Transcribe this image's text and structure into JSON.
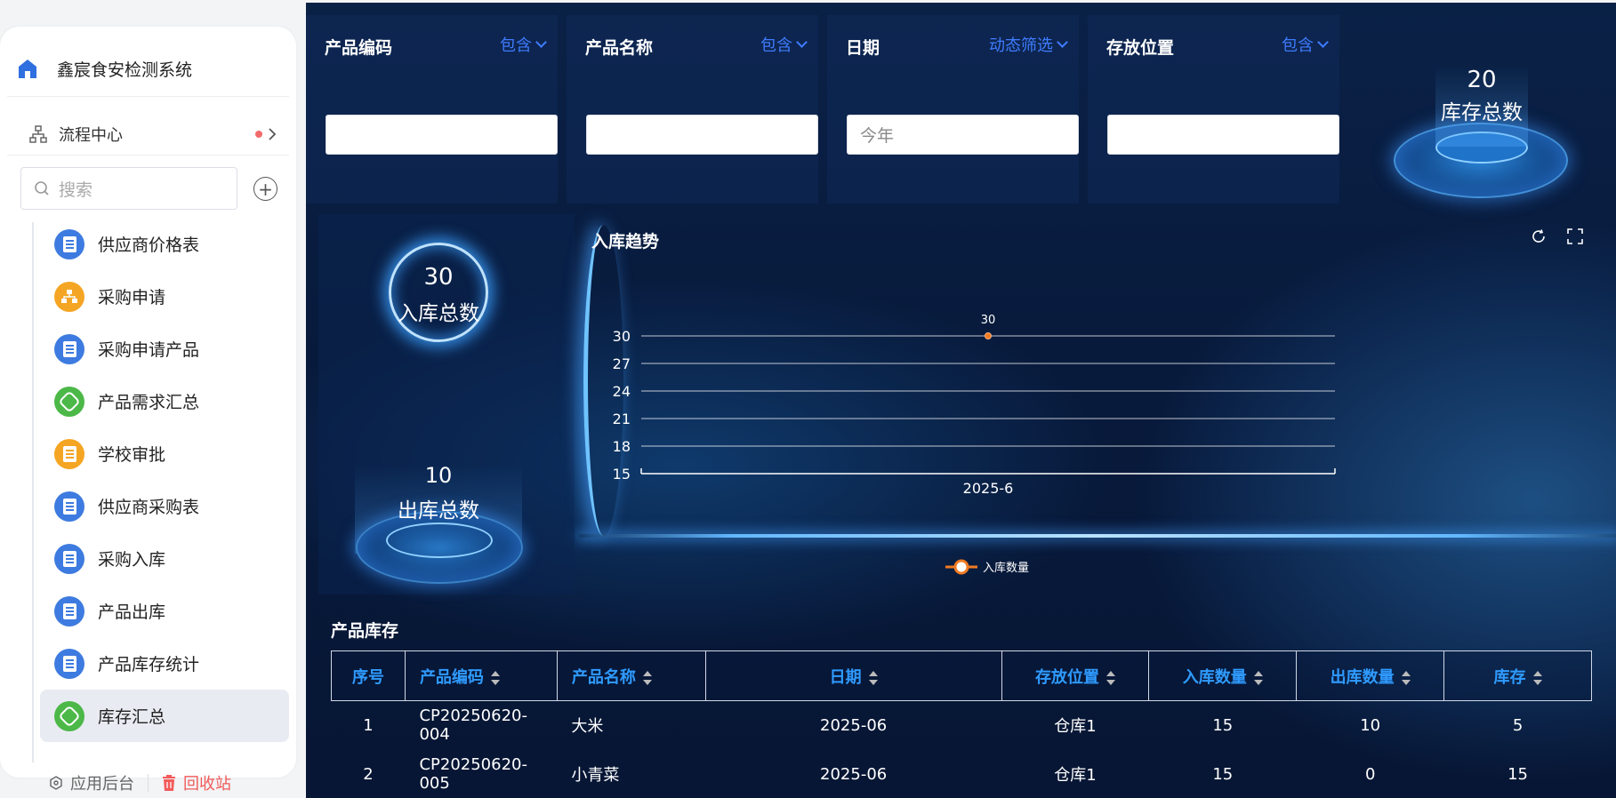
{
  "app": {
    "title": "鑫宸食安检测系统"
  },
  "sidebar": {
    "flow_center": "流程中心",
    "search_placeholder": "搜索",
    "items": [
      {
        "label": "供应商价格表",
        "icon": "document-icon",
        "color": "#3e7be0"
      },
      {
        "label": "采购申请",
        "icon": "org-icon",
        "color": "#f5a524"
      },
      {
        "label": "采购申请产品",
        "icon": "document-icon",
        "color": "#3e7be0"
      },
      {
        "label": "产品需求汇总",
        "icon": "dashboard-icon",
        "color": "#4cb848"
      },
      {
        "label": "学校审批",
        "icon": "document-icon",
        "color": "#f5a524"
      },
      {
        "label": "供应商采购表",
        "icon": "document-icon",
        "color": "#3e7be0"
      },
      {
        "label": "采购入库",
        "icon": "document-icon",
        "color": "#3e7be0"
      },
      {
        "label": "产品出库",
        "icon": "document-icon",
        "color": "#3e7be0"
      },
      {
        "label": "产品库存统计",
        "icon": "document-icon",
        "color": "#3e7be0"
      },
      {
        "label": "库存汇总",
        "icon": "dashboard-icon",
        "color": "#4cb848",
        "active": true
      }
    ],
    "bottom": {
      "admin": "应用后台",
      "recycle": "回收站"
    }
  },
  "filters": [
    {
      "label": "产品编码",
      "mode": "包含",
      "value": ""
    },
    {
      "label": "产品名称",
      "mode": "包含",
      "value": ""
    },
    {
      "label": "日期",
      "mode": "动态筛选",
      "value": "今年"
    },
    {
      "label": "存放位置",
      "mode": "包含",
      "value": ""
    }
  ],
  "stats": {
    "stock_total": {
      "value": "20",
      "label": "库存总数"
    },
    "inbound_total": {
      "value": "30",
      "label": "入库总数"
    },
    "outbound_total": {
      "value": "10",
      "label": "出库总数"
    }
  },
  "chart_title": "入库趋势",
  "chart_data": {
    "type": "line",
    "title": "入库趋势",
    "categories": [
      "2025-6"
    ],
    "series": [
      {
        "name": "入库数量",
        "values": [
          30
        ],
        "color": "#f07a22"
      }
    ],
    "yticks": [
      15,
      18,
      21,
      24,
      27,
      30
    ],
    "ylim": [
      15,
      30
    ],
    "data_labels": [
      "30"
    ],
    "legend_position": "bottom"
  },
  "table": {
    "title": "产品库存",
    "columns": [
      "序号",
      "产品编码",
      "产品名称",
      "日期",
      "存放位置",
      "入库数量",
      "出库数量",
      "库存"
    ],
    "rows": [
      [
        "1",
        "CP20250620-004",
        "大米",
        "2025-06",
        "仓库1",
        "15",
        "10",
        "5"
      ],
      [
        "2",
        "CP20250620-005",
        "小青菜",
        "2025-06",
        "仓库1",
        "15",
        "0",
        "15"
      ]
    ]
  }
}
